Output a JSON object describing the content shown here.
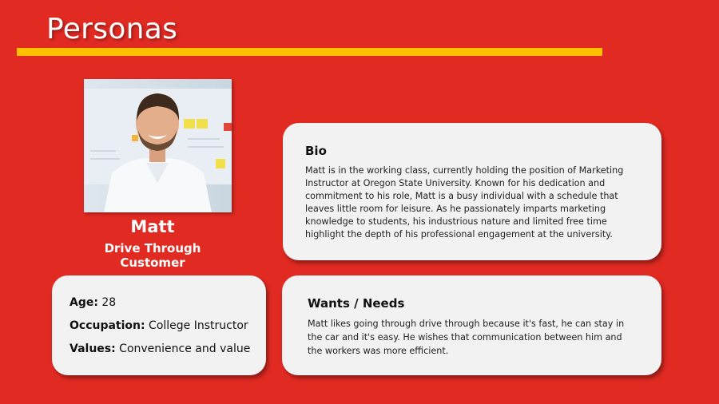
{
  "slide": {
    "title": "Personas",
    "accent_color": "#ffc000",
    "background_color": "#e02a22"
  },
  "persona": {
    "photo_icon": "person-photo",
    "name": "Matt",
    "role": "Drive Through Customer"
  },
  "bio": {
    "heading": "Bio",
    "text": "Matt is  in the working class, currently holding the position of Marketing Instructor at Oregon State University. Known for his dedication and commitment to his role, Matt is a busy individual with a schedule that leaves little room for leisure. As he passionately imparts marketing knowledge to students, his industrious nature and limited free time highlight the depth of his professional engagement at the university."
  },
  "facts": {
    "age_label": "Age:",
    "age_value": " 28",
    "occupation_label": "Occupation:",
    "occupation_value": " College Instructor",
    "values_label": "Values:",
    "values_value": " Convenience and value"
  },
  "wants": {
    "heading": "Wants / Needs",
    "text": "Matt likes going through drive through because it's fast, he can stay in the car and it's easy. He wishes that communication between him and the workers was more efficient."
  }
}
